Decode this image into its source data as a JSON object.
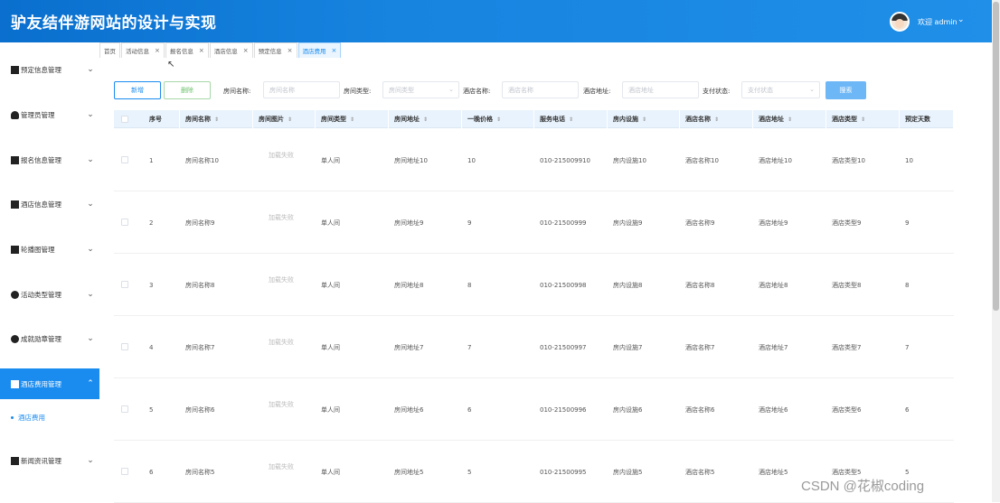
{
  "header": {
    "title": "驴友结伴游网站的设计与实现",
    "welcome": "欢迎 admin"
  },
  "sidebar": {
    "items": [
      {
        "label": "预定信息管理",
        "icon": "image-icon"
      },
      {
        "label": "管理员管理",
        "icon": "user-icon"
      },
      {
        "label": "报名信息管理",
        "icon": "book-icon"
      },
      {
        "label": "酒店信息管理",
        "icon": "grid-icon"
      },
      {
        "label": "轮播图管理",
        "icon": "grid-icon"
      },
      {
        "label": "活动类型管理",
        "icon": "circle-icon"
      },
      {
        "label": "成就勋章管理",
        "icon": "badge-icon"
      },
      {
        "label": "酒店费用管理",
        "icon": "grid-icon"
      },
      {
        "label": "新闻资讯管理",
        "icon": "message-icon"
      }
    ],
    "submenu": "酒店费用",
    "active_index": 7
  },
  "tabs": [
    {
      "label": "首页",
      "closable": false
    },
    {
      "label": "活动信息",
      "closable": true
    },
    {
      "label": "报名信息",
      "closable": true
    },
    {
      "label": "酒店信息",
      "closable": true
    },
    {
      "label": "预定信息",
      "closable": true
    },
    {
      "label": "酒店费用",
      "closable": true,
      "active": true
    }
  ],
  "toolbar": {
    "add_label": "新增",
    "delete_label": "删除",
    "search_label": "搜索",
    "filters": [
      {
        "label": "房间名称:",
        "placeholder": "房间名称"
      },
      {
        "label": "房间类型:",
        "placeholder": "房间类型"
      },
      {
        "label": "酒店名称:",
        "placeholder": "酒店名称"
      },
      {
        "label": "酒店地址:",
        "placeholder": "酒店地址"
      },
      {
        "label": "支付状态:",
        "placeholder": "支付状态"
      }
    ]
  },
  "table": {
    "columns": [
      "序号",
      "房间名称",
      "房间图片",
      "房间类型",
      "房间地址",
      "一晚价格",
      "服务电话",
      "房内设施",
      "酒店名称",
      "酒店地址",
      "酒店类型",
      "预定天数"
    ],
    "rows": [
      [
        "1",
        "房间名称10",
        "加载失败",
        "单人间",
        "房间地址10",
        "10",
        "010-215009910",
        "房内设施10",
        "酒店名称10",
        "酒店地址10",
        "酒店类型10",
        "10"
      ],
      [
        "2",
        "房间名称9",
        "加载失败",
        "单人间",
        "房间地址9",
        "9",
        "010-21500999",
        "房内设施9",
        "酒店名称9",
        "酒店地址9",
        "酒店类型9",
        "9"
      ],
      [
        "3",
        "房间名称8",
        "加载失败",
        "单人间",
        "房间地址8",
        "8",
        "010-21500998",
        "房内设施8",
        "酒店名称8",
        "酒店地址8",
        "酒店类型8",
        "8"
      ],
      [
        "4",
        "房间名称7",
        "加载失败",
        "单人间",
        "房间地址7",
        "7",
        "010-21500997",
        "房内设施7",
        "酒店名称7",
        "酒店地址7",
        "酒店类型7",
        "7"
      ],
      [
        "5",
        "房间名称6",
        "加载失败",
        "单人间",
        "房间地址6",
        "6",
        "010-21500996",
        "房内设施6",
        "酒店名称6",
        "酒店地址6",
        "酒店类型6",
        "6"
      ],
      [
        "6",
        "房间名称5",
        "加载失败",
        "单人间",
        "房间地址5",
        "5",
        "010-21500995",
        "房内设施5",
        "酒店名称5",
        "酒店地址5",
        "酒店类型5",
        "5"
      ]
    ]
  },
  "watermark": "CSDN @花椒coding",
  "colors": {
    "primary": "#1a8cf0",
    "header": "#1784e0",
    "table_head": "#e8f3fd"
  }
}
